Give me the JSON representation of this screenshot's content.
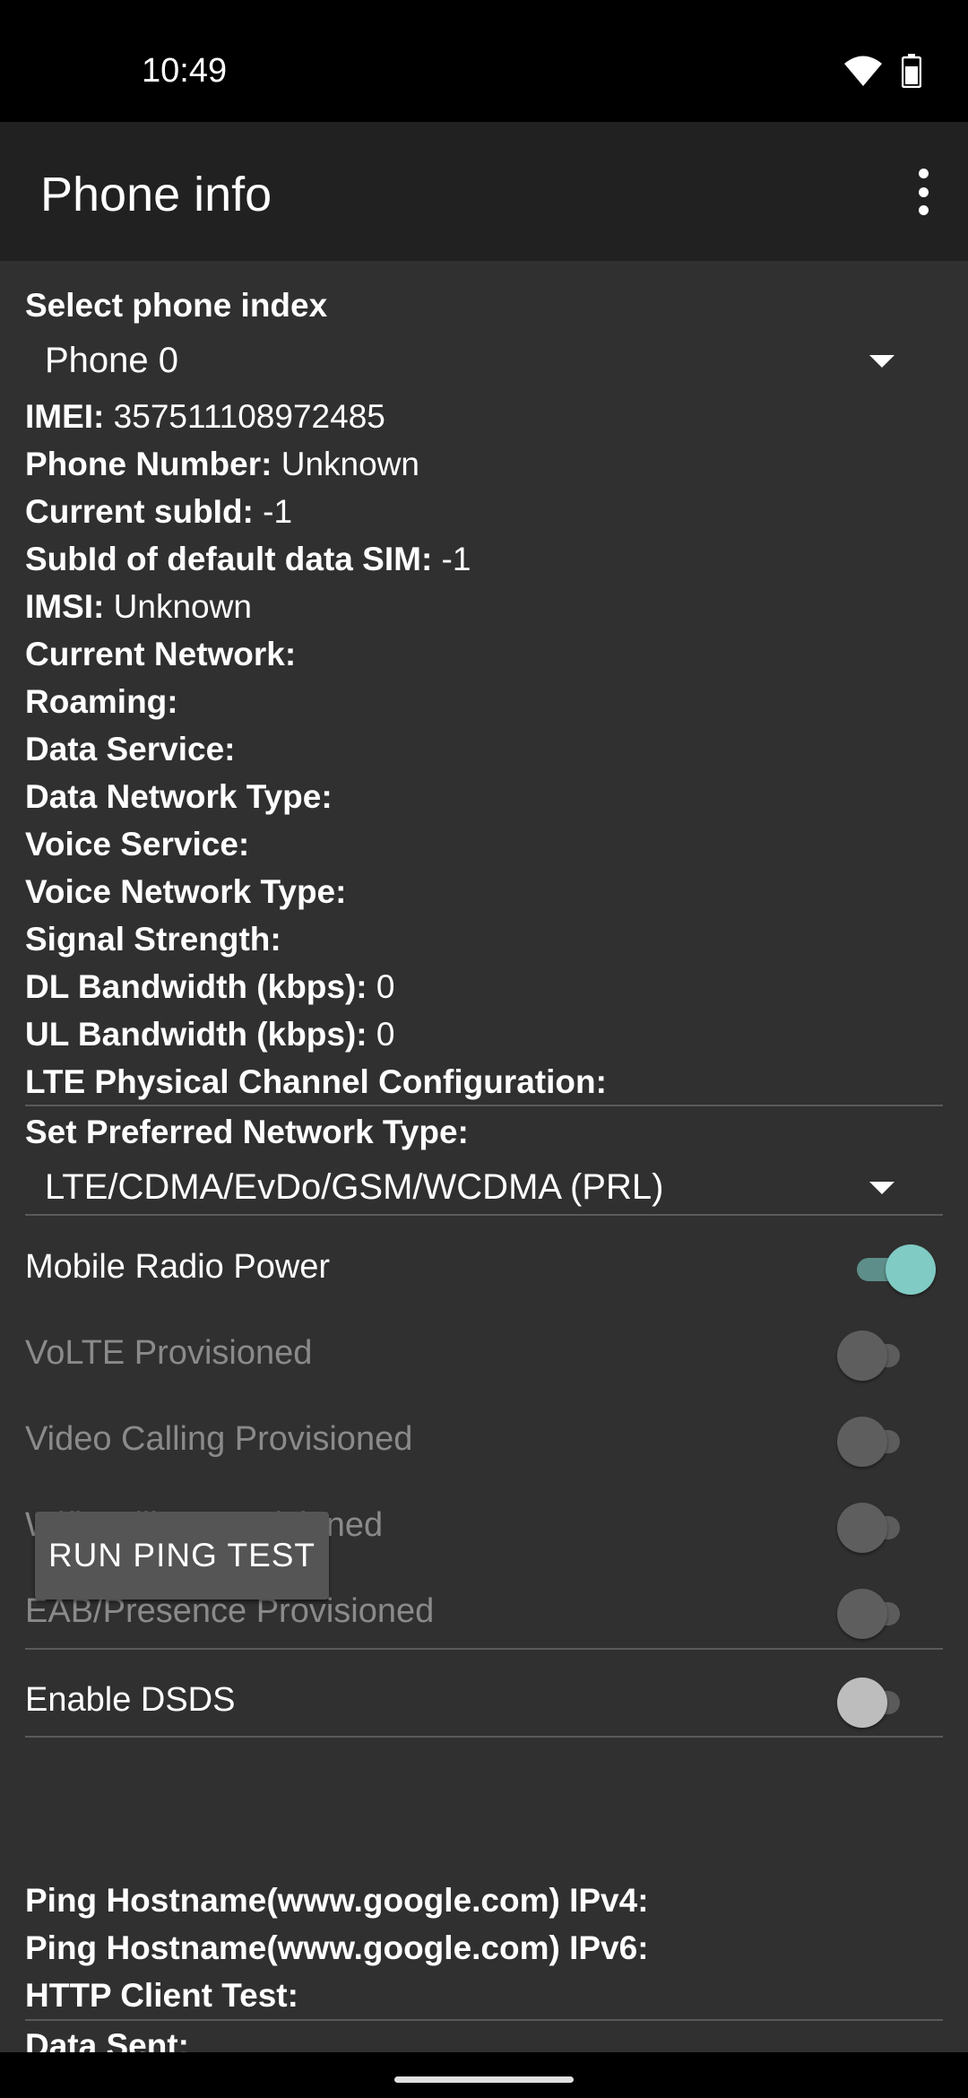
{
  "status_bar": {
    "time": "10:49",
    "wifi_icon": "wifi-icon",
    "battery_icon": "battery-icon"
  },
  "app_bar": {
    "title": "Phone info",
    "menu_icon": "more-vert-icon"
  },
  "phone_index": {
    "label": "Select phone index",
    "value": "Phone 0"
  },
  "info": [
    {
      "label": "IMEI:",
      "value": "357511108972485"
    },
    {
      "label": "Phone Number:",
      "value": "Unknown"
    },
    {
      "label": "Current subId:",
      "value": "-1"
    },
    {
      "label": "SubId of default data SIM:",
      "value": "-1"
    },
    {
      "label": "IMSI:",
      "value": "Unknown"
    },
    {
      "label": "Current Network:",
      "value": ""
    },
    {
      "label": "Roaming:",
      "value": ""
    },
    {
      "label": "Data Service:",
      "value": ""
    },
    {
      "label": "Data Network Type:",
      "value": ""
    },
    {
      "label": "Voice Service:",
      "value": ""
    },
    {
      "label": "Voice Network Type:",
      "value": ""
    },
    {
      "label": "Signal Strength:",
      "value": ""
    },
    {
      "label": "DL Bandwidth (kbps):",
      "value": "0"
    },
    {
      "label": "UL Bandwidth (kbps):",
      "value": "0"
    },
    {
      "label": "LTE Physical Channel Configuration:",
      "value": ""
    }
  ],
  "preferred_network": {
    "label": "Set Preferred Network Type:",
    "value": "LTE/CDMA/EvDo/GSM/WCDMA (PRL)"
  },
  "switches": [
    {
      "label": "Mobile Radio Power",
      "checked": true,
      "enabled": true
    },
    {
      "label": "VoLTE Provisioned",
      "checked": false,
      "enabled": false
    },
    {
      "label": "Video Calling Provisioned",
      "checked": false,
      "enabled": false
    },
    {
      "label": "Wifi Calling Provisioned",
      "checked": false,
      "enabled": false
    },
    {
      "label": "EAB/Presence Provisioned",
      "checked": false,
      "enabled": false
    },
    {
      "label": "Enable DSDS",
      "checked": false,
      "enabled": true
    }
  ],
  "ping_button": "RUN PING TEST",
  "results": [
    {
      "label": "Ping Hostname(www.google.com) IPv4:"
    },
    {
      "label": "Ping Hostname(www.google.com) IPv6:"
    },
    {
      "label": "HTTP Client Test:"
    },
    {
      "label": "Data Sent:"
    }
  ],
  "colors": {
    "background": "#303030",
    "app_bar": "#212121",
    "accent": "#80cbc4"
  }
}
